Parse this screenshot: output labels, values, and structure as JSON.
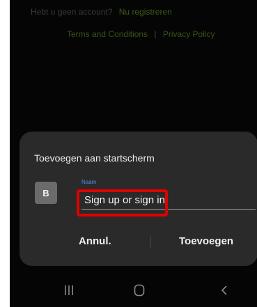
{
  "background_page": {
    "signup_prompt": "Hebt u geen account?",
    "signup_link": "Nu registreren",
    "terms_link": "Terms and Conditions",
    "separator": "|",
    "privacy_link": "Privacy Policy"
  },
  "dialog": {
    "title": "Toevoegen aan startscherm",
    "app_icon_letter": "B",
    "name_label": "Naam",
    "name_value": "Sign up or sign in",
    "cancel_label": "Annul.",
    "add_label": "Toevoegen"
  },
  "navbar": {
    "icons": [
      "recent-apps-icon",
      "home-icon",
      "back-icon"
    ]
  },
  "colors": {
    "highlight": "#e00000",
    "accent_label": "#4f8ee8",
    "dialog_bg": "#2a2a2a"
  }
}
